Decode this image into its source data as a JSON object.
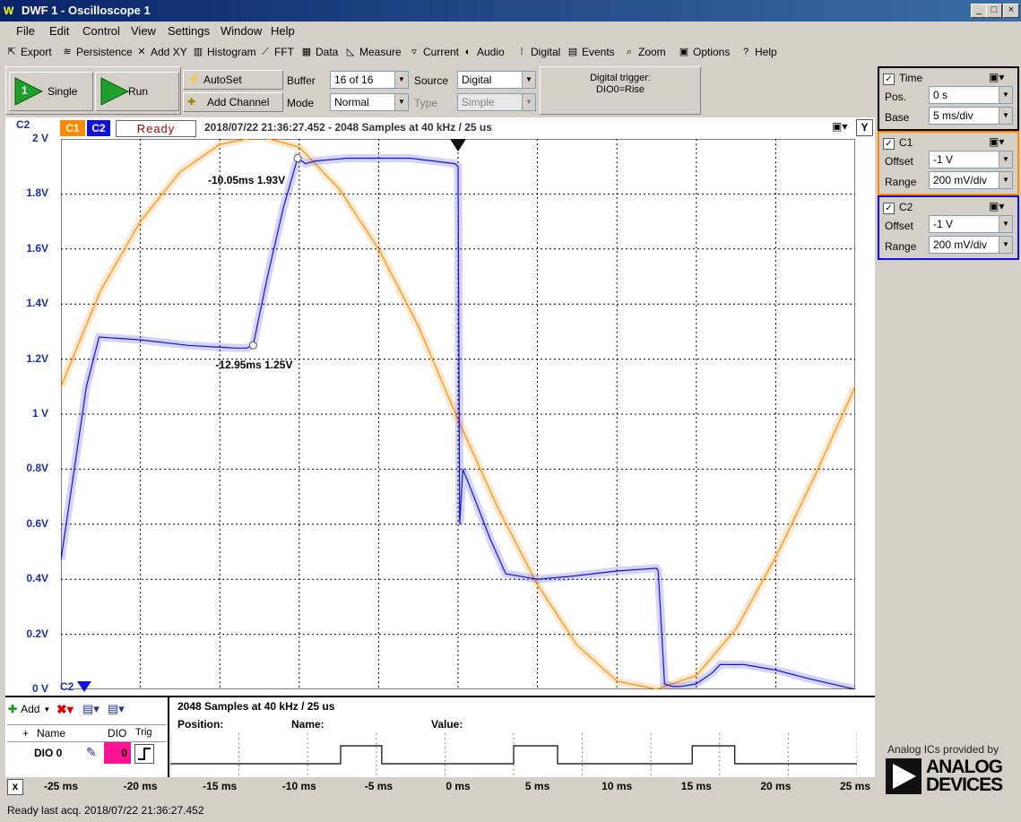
{
  "window": {
    "title": "DWF 1 - Oscilloscope 1",
    "logo": "W"
  },
  "menu": [
    "File",
    "Edit",
    "Control",
    "View",
    "Settings",
    "Window",
    "Help"
  ],
  "toolbar": [
    {
      "label": "Export",
      "icon": "export-icon"
    },
    {
      "label": "Persistence",
      "icon": "persistence-icon"
    },
    {
      "label": "Add XY",
      "icon": "xy-icon"
    },
    {
      "label": "Histogram",
      "icon": "histogram-icon"
    },
    {
      "label": "FFT",
      "icon": "fft-icon"
    },
    {
      "label": "Data",
      "icon": "data-icon"
    },
    {
      "label": "Measure",
      "icon": "measure-icon"
    },
    {
      "label": "Current",
      "icon": "current-icon"
    },
    {
      "label": "Audio",
      "icon": "audio-icon"
    },
    {
      "label": "Digital",
      "icon": "digital-icon"
    },
    {
      "label": "Events",
      "icon": "events-icon"
    },
    {
      "label": "Zoom",
      "icon": "zoom-icon"
    },
    {
      "label": "Options",
      "icon": "options-icon"
    },
    {
      "label": "Help",
      "icon": "help-icon"
    }
  ],
  "controls": {
    "single": "Single",
    "single_badge": "1",
    "run": "Run",
    "autoset": "AutoSet",
    "add_channel": "Add Channel",
    "buffer_label": "Buffer",
    "buffer_value": "16 of 16",
    "mode_label": "Mode",
    "mode_value": "Normal",
    "source_label": "Source",
    "source_value": "Digital",
    "type_label": "Type",
    "type_value": "Simple",
    "trigger_line1": "Digital trigger:",
    "trigger_line2": "DIO0=Rise"
  },
  "scope_header": {
    "c1": "C1",
    "c2": "C2",
    "status": "Ready",
    "left_tag": "C2",
    "info": "2018/07/22  21:36:27.452 - 2048 Samples at 40 kHz / 25 us",
    "y_button": "Y",
    "bottom_tag": "C2"
  },
  "colors": {
    "c1": "#ff8a00",
    "c2": "#1010e0",
    "status_text": "#9b0000"
  },
  "y_ticks": [
    "2 V",
    "1.8V",
    "1.6V",
    "1.4V",
    "1.2V",
    "1 V",
    "0.8V",
    "0.6V",
    "0.4V",
    "0.2V",
    "0 V"
  ],
  "x_ticks": [
    "-25 ms",
    "-20 ms",
    "-15 ms",
    "-10 ms",
    "-5 ms",
    "0 ms",
    "5 ms",
    "10 ms",
    "15 ms",
    "20 ms",
    "25 ms"
  ],
  "cursors": [
    {
      "label": "-10.05ms 1.93V"
    },
    {
      "label": "-12.95ms 1.25V"
    }
  ],
  "chart_data": {
    "type": "line",
    "xlim": [
      -25,
      25
    ],
    "ylim": [
      0,
      2
    ],
    "grid": true,
    "series": [
      {
        "name": "C1",
        "color": "#ff8a00",
        "x": [
          -25,
          -22.5,
          -20,
          -17.5,
          -15,
          -12.5,
          -10,
          -7.5,
          -5,
          -2.5,
          0,
          2.5,
          5,
          7.5,
          10,
          12.5,
          15,
          17.5,
          20,
          22.5,
          25
        ],
        "y": [
          1.1,
          1.45,
          1.7,
          1.88,
          1.98,
          2.01,
          1.97,
          1.82,
          1.6,
          1.32,
          0.98,
          0.66,
          0.38,
          0.16,
          0.03,
          0.0,
          0.05,
          0.22,
          0.48,
          0.78,
          1.1
        ]
      },
      {
        "name": "C2",
        "color": "#1010e0",
        "x": [
          -25,
          -23.4,
          -22.6,
          -20,
          -17,
          -14,
          -13.3,
          -12.9,
          -12,
          -11,
          -10.1,
          -9.6,
          -9,
          -7,
          -5,
          -3,
          -0.2,
          0,
          0.1,
          0.3,
          1,
          2,
          3,
          5,
          7,
          10,
          12.5,
          12.6,
          13,
          13.5,
          14,
          15,
          16,
          16.5,
          18,
          20,
          22,
          25
        ],
        "y": [
          0.47,
          1.1,
          1.28,
          1.27,
          1.25,
          1.24,
          1.24,
          1.25,
          1.5,
          1.75,
          1.93,
          1.91,
          1.92,
          1.93,
          1.93,
          1.93,
          1.91,
          1.9,
          0.6,
          0.8,
          0.7,
          0.55,
          0.42,
          0.4,
          0.41,
          0.43,
          0.44,
          0.43,
          0.02,
          0.01,
          0.01,
          0.02,
          0.06,
          0.09,
          0.09,
          0.07,
          0.04,
          0.0
        ]
      }
    ]
  },
  "right": {
    "time": {
      "title": "Time",
      "pos_label": "Pos.",
      "pos_value": "0 s",
      "base_label": "Base",
      "base_value": "5 ms/div"
    },
    "c1": {
      "title": "C1",
      "offset_label": "Offset",
      "offset_value": "-1 V",
      "range_label": "Range",
      "range_value": "200 mV/div",
      "color": "#ff8a00"
    },
    "c2": {
      "title": "C2",
      "offset_label": "Offset",
      "offset_value": "-1 V",
      "range_label": "Range",
      "range_value": "200 mV/div",
      "color": "#1010e0"
    },
    "brand_caption": "Analog ICs provided by",
    "brand_name_1": "ANALOG",
    "brand_name_2": "DEVICES"
  },
  "logic": {
    "add": "Add",
    "col_plus": "+",
    "col_name": "Name",
    "col_dio": "DIO",
    "col_trig": "Trig",
    "row_name": "DIO 0",
    "row_dio": "0",
    "info": "2048 Samples at 40 kHz / 25 us",
    "position_label": "Position:",
    "name_label": "Name:",
    "value_label": "Value:",
    "digital_x": [
      -25,
      -12.6,
      -12.6,
      -9.6,
      -9.6,
      0,
      0,
      3.2,
      3.2,
      13,
      13,
      16.1,
      16.1,
      25
    ],
    "digital_y": [
      0,
      0,
      1,
      1,
      0,
      0,
      1,
      1,
      0,
      0,
      1,
      1,
      0,
      0
    ],
    "close": "x"
  },
  "status": "Ready last acq. 2018/07/22  21:36:27.452"
}
